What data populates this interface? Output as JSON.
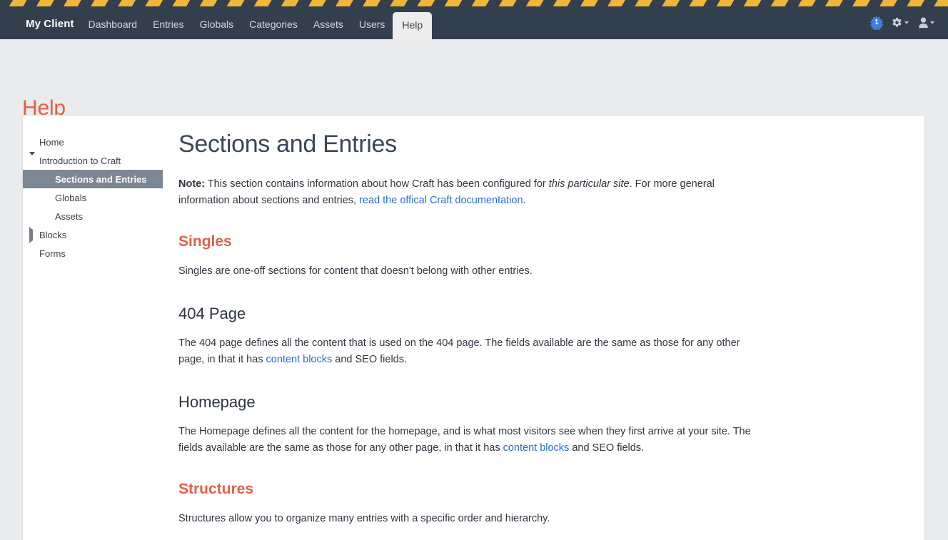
{
  "colors": {
    "header_bg": "#333f4d",
    "stripe": "#f0b637",
    "accent_red": "#e4604b",
    "link_blue": "#2a6be0",
    "selected_nav": "#7c8794",
    "page_bg": "#eaebec"
  },
  "header": {
    "brand": "My Client",
    "nav": [
      {
        "label": "Dashboard",
        "selected": false
      },
      {
        "label": "Entries",
        "selected": false
      },
      {
        "label": "Globals",
        "selected": false
      },
      {
        "label": "Categories",
        "selected": false
      },
      {
        "label": "Assets",
        "selected": false
      },
      {
        "label": "Users",
        "selected": false
      },
      {
        "label": "Help",
        "selected": true
      }
    ],
    "notification_count": "1",
    "icons": {
      "notification": "starburst-badge-icon",
      "settings": "gear-icon",
      "account": "user-icon"
    }
  },
  "page": {
    "title": "Help"
  },
  "sidebar": {
    "items": [
      {
        "label": "Home",
        "level": 0,
        "toggle": "none",
        "selected": false
      },
      {
        "label": "Introduction to Craft",
        "level": 0,
        "toggle": "down",
        "selected": false
      },
      {
        "label": "Sections and Entries",
        "level": 1,
        "toggle": "none",
        "selected": true
      },
      {
        "label": "Globals",
        "level": 1,
        "toggle": "none",
        "selected": false
      },
      {
        "label": "Assets",
        "level": 1,
        "toggle": "none",
        "selected": false
      },
      {
        "label": "Blocks",
        "level": 0,
        "toggle": "right",
        "selected": false
      },
      {
        "label": "Forms",
        "level": 0,
        "toggle": "none",
        "selected": false
      }
    ]
  },
  "main": {
    "title": "Sections and Entries",
    "note": {
      "label": "Note:",
      "text_1": " This section contains information about how Craft has been configured for ",
      "emphasis": "this particular site",
      "text_2": ". For more general information about sections and entries, ",
      "link": "read the offical Craft documentation",
      "text_3": "."
    },
    "sections": [
      {
        "heading": "Singles",
        "intro": "Singles are one-off sections for content that doesn't belong with other entries."
      },
      {
        "heading": "Structures",
        "intro": "Structures allow you to organize many entries with a specific order and hierarchy."
      }
    ],
    "singles": [
      {
        "heading": "404 Page",
        "text_1": "The 404 page defines all the content that is used on the 404 page. The fields available are the same as those for any other page, in that it has ",
        "link": "content blocks",
        "text_2": " and SEO fields."
      },
      {
        "heading": "Homepage",
        "text_1": "The Homepage defines all the content for the homepage, and is what most visitors see when they first arrive at your site. The fields available are the same as those for any other page, in that it has ",
        "link": "content blocks",
        "text_2": " and SEO fields."
      }
    ]
  }
}
